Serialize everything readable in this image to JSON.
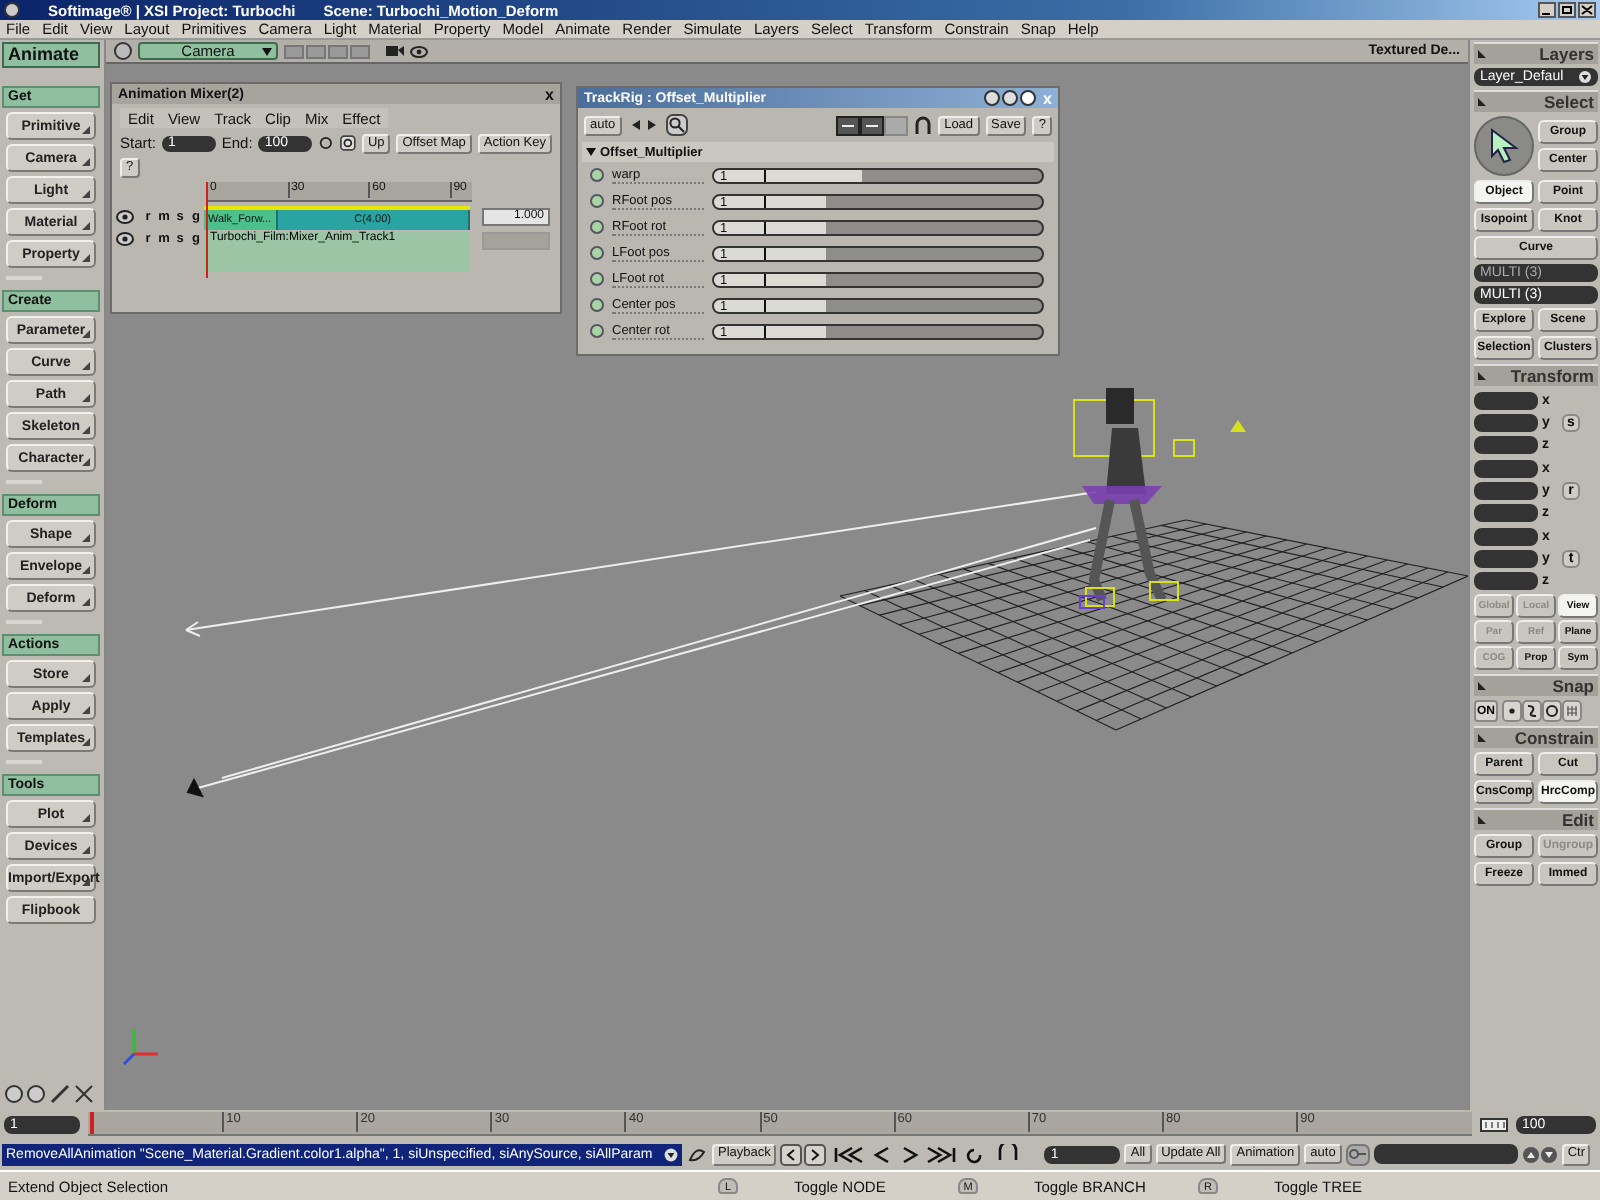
{
  "window": {
    "title": "Softimage® | XSI Project: Turbochi",
    "scene": "Scene: Turbochi_Motion_Deform"
  },
  "menu": [
    "File",
    "Edit",
    "View",
    "Layout",
    "Primitives",
    "Camera",
    "Light",
    "Material",
    "Property",
    "Model",
    "Animate",
    "Render",
    "Simulate",
    "Layers",
    "Select",
    "Transform",
    "Constrain",
    "Snap",
    "Help"
  ],
  "left_panel": {
    "mode": "Animate",
    "sections": [
      {
        "title": "Get",
        "buttons": [
          {
            "label": "Primitive",
            "arrow": true
          },
          {
            "label": "Camera",
            "arrow": true
          },
          {
            "label": "Light",
            "arrow": true
          },
          {
            "label": "Material",
            "arrow": true
          },
          {
            "label": "Property",
            "arrow": true
          }
        ]
      },
      {
        "title": "Create",
        "buttons": [
          {
            "label": "Parameter",
            "arrow": true
          },
          {
            "label": "Curve",
            "arrow": true
          },
          {
            "label": "Path",
            "arrow": true
          },
          {
            "label": "Skeleton",
            "arrow": true
          },
          {
            "label": "Character",
            "arrow": true
          }
        ]
      },
      {
        "title": "Deform",
        "buttons": [
          {
            "label": "Shape",
            "arrow": true
          },
          {
            "label": "Envelope",
            "arrow": true
          },
          {
            "label": "Deform",
            "arrow": true
          }
        ]
      },
      {
        "title": "Actions",
        "buttons": [
          {
            "label": "Store",
            "arrow": true
          },
          {
            "label": "Apply",
            "arrow": true
          },
          {
            "label": "Templates",
            "arrow": true
          }
        ]
      },
      {
        "title": "Tools",
        "buttons": [
          {
            "label": "Plot",
            "arrow": true
          },
          {
            "label": "Devices",
            "arrow": true
          },
          {
            "label": "Import/Export",
            "arrow": true
          },
          {
            "label": "Flipbook",
            "arrow": false
          }
        ]
      }
    ]
  },
  "viewport": {
    "camera": "Camera",
    "shading": "Textured De..."
  },
  "mixer": {
    "title": "Animation Mixer(2)",
    "close": "x",
    "menu": [
      "Edit",
      "View",
      "Track",
      "Clip",
      "Mix",
      "Effect"
    ],
    "start_label": "Start:",
    "start": "1",
    "end_label": "End:",
    "end": "100",
    "buttons": [
      "Up",
      "Offset Map",
      "Action Key"
    ],
    "help": "?",
    "ruler": [
      "0",
      "30",
      "60",
      "90"
    ],
    "tracks": [
      {
        "kind": "clips",
        "letters": [
          "r",
          "m",
          "s",
          "g"
        ],
        "clips": [
          {
            "label": "Walk_Forw...",
            "color": "#4cc08a"
          },
          {
            "label": "C(4.00)",
            "color": "#2aa3a3"
          }
        ],
        "weight": "1.000"
      },
      {
        "kind": "name",
        "letters": [
          "r",
          "m",
          "s",
          "g"
        ],
        "name": "Turbochi_Film:Mixer_Anim_Track1"
      }
    ]
  },
  "trackrig": {
    "title": "TrackRig : Offset_Multiplier",
    "close": "x",
    "auto": "auto",
    "load": "Load",
    "save": "Save",
    "help": "?",
    "group": "Offset_Multiplier",
    "params": [
      {
        "name": "warp",
        "value": "1",
        "level": 0.45
      },
      {
        "name": "RFoot pos",
        "value": "1",
        "level": 0.34
      },
      {
        "name": "RFoot rot",
        "value": "1",
        "level": 0.34
      },
      {
        "name": "LFoot pos",
        "value": "1",
        "level": 0.34
      },
      {
        "name": "LFoot rot",
        "value": "1",
        "level": 0.34
      },
      {
        "name": "Center pos",
        "value": "1",
        "level": 0.34
      },
      {
        "name": "Center rot",
        "value": "1",
        "level": 0.34
      }
    ]
  },
  "right_panel": {
    "layers_title": "Layers",
    "layer": "Layer_Defaul",
    "select_title": "Select",
    "select_side": [
      {
        "label": "Group",
        "selected": false,
        "disabled": false
      },
      {
        "label": "Center",
        "selected": false,
        "disabled": false
      }
    ],
    "select_buttons": [
      {
        "label": "Object",
        "selected": true,
        "disabled": false
      },
      {
        "label": "Point",
        "selected": false,
        "disabled": false
      },
      {
        "label": "Isopoint",
        "selected": false,
        "disabled": false
      },
      {
        "label": "Knot",
        "selected": false,
        "disabled": false
      }
    ],
    "curve": "Curve",
    "fields": [
      "MULTI (3)",
      "MULTI (3)"
    ],
    "explore_buttons": [
      {
        "label": "Explore",
        "selected": false,
        "disabled": false
      },
      {
        "label": "Scene",
        "selected": false,
        "disabled": false
      },
      {
        "label": "Selection",
        "selected": false,
        "disabled": false
      },
      {
        "label": "Clusters",
        "selected": false,
        "disabled": false
      }
    ],
    "transform_title": "Transform",
    "transform_groups": [
      {
        "tool": "s",
        "axes": [
          "x",
          "y",
          "z"
        ]
      },
      {
        "tool": "r",
        "axes": [
          "x",
          "y",
          "z"
        ]
      },
      {
        "tool": "t",
        "axes": [
          "x",
          "y",
          "z"
        ]
      }
    ],
    "modes": [
      {
        "label": "Global",
        "selected": false,
        "disabled": true
      },
      {
        "label": "Local",
        "selected": false,
        "disabled": true
      },
      {
        "label": "View",
        "selected": true,
        "disabled": false
      },
      {
        "label": "Par",
        "selected": false,
        "disabled": true
      },
      {
        "label": "Ref",
        "selected": false,
        "disabled": true
      },
      {
        "label": "Plane",
        "selected": false,
        "disabled": false
      },
      {
        "label": "COG",
        "selected": false,
        "disabled": true
      },
      {
        "label": "Prop",
        "selected": false,
        "disabled": false
      },
      {
        "label": "Sym",
        "selected": false,
        "disabled": false
      }
    ],
    "snap_title": "Snap",
    "snap_on": "ON",
    "constrain_title": "Constrain",
    "constrain_buttons": [
      {
        "label": "Parent",
        "selected": false,
        "disabled": false
      },
      {
        "label": "Cut",
        "selected": false,
        "disabled": false
      },
      {
        "label": "CnsComp",
        "selected": false,
        "disabled": false
      },
      {
        "label": "HrcComp",
        "selected": true,
        "disabled": false
      }
    ],
    "edit_title": "Edit",
    "edit_buttons": [
      {
        "label": "Group",
        "selected": false,
        "disabled": false
      },
      {
        "label": "Ungroup",
        "selected": false,
        "disabled": true
      },
      {
        "label": "Freeze",
        "selected": false,
        "disabled": false
      },
      {
        "label": "Immed",
        "selected": false,
        "disabled": false
      }
    ]
  },
  "timeline": {
    "start": "1",
    "ticks": [
      "10",
      "20",
      "30",
      "40",
      "50",
      "60",
      "70",
      "80",
      "90"
    ],
    "end": "100"
  },
  "command_bar": {
    "command": "RemoveAllAnimation \"Scene_Material.Gradient.color1.alpha\", 1, siUnspecified, siAnySource, siAllParam",
    "playback": "Playback",
    "frame": "1",
    "all": "All",
    "update_all": "Update All",
    "animation": "Animation",
    "auto": "auto",
    "ctr": "Ctr"
  },
  "status_bar": {
    "message": "Extend Object Selection",
    "toggles": [
      {
        "key": "L",
        "label": "Toggle NODE"
      },
      {
        "key": "M",
        "label": "Toggle BRANCH"
      },
      {
        "key": "R",
        "label": "Toggle TREE"
      }
    ]
  }
}
